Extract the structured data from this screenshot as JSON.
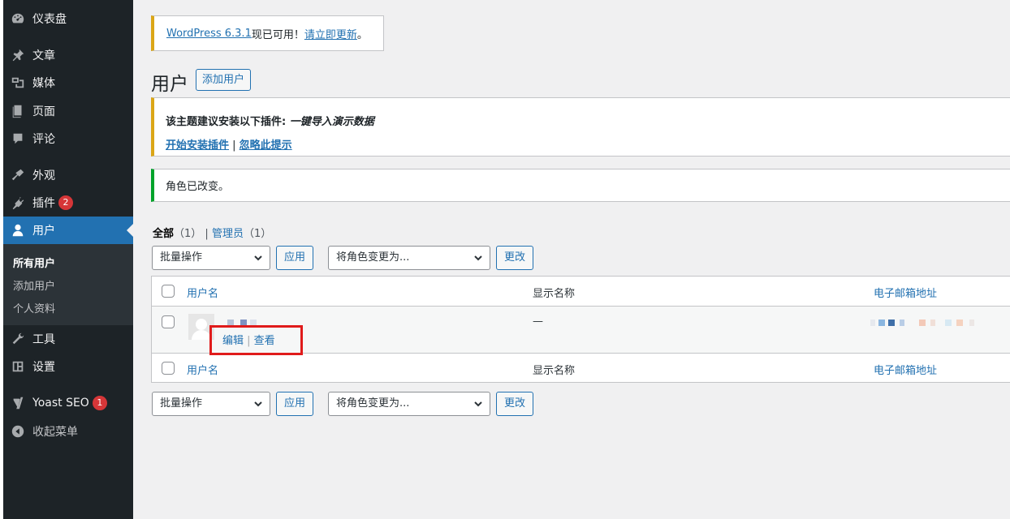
{
  "sidebar": {
    "items": [
      {
        "label": "仪表盘",
        "icon": "dashboard-icon"
      },
      {
        "label": "文章",
        "icon": "pin-icon"
      },
      {
        "label": "媒体",
        "icon": "media-icon"
      },
      {
        "label": "页面",
        "icon": "page-icon"
      },
      {
        "label": "评论",
        "icon": "comment-icon"
      },
      {
        "label": "外观",
        "icon": "appearance-icon"
      },
      {
        "label": "插件",
        "icon": "plugin-icon",
        "badge": "2"
      },
      {
        "label": "用户",
        "icon": "user-icon",
        "active": true
      },
      {
        "label": "工具",
        "icon": "wrench-icon"
      },
      {
        "label": "设置",
        "icon": "settings-icon"
      },
      {
        "label": "Yoast SEO",
        "icon": "yoast-icon",
        "badge": "1"
      },
      {
        "label": "收起菜单",
        "icon": "collapse-icon"
      }
    ],
    "submenu": [
      "所有用户",
      "添加用户",
      "个人资料"
    ]
  },
  "update_nag": {
    "version_link": "WordPress 6.3.1",
    "middle": "现已可用！",
    "action_link": "请立即更新",
    "end": "。"
  },
  "page": {
    "title": "用户",
    "add_button": "添加用户"
  },
  "plugin_notice": {
    "prefix": "该主题建议安装以下插件: ",
    "plugin": "一键导入演示数据",
    "install_link": "开始安装插件",
    "sep": " | ",
    "dismiss_link": "忽略此提示"
  },
  "success_notice": "角色已改变。",
  "filters": {
    "all_label": "全部",
    "all_count": "（1）",
    "sep": " | ",
    "admin_label": "管理员",
    "admin_count": "（1）"
  },
  "bulk": {
    "select_label": "批量操作",
    "apply": "应用",
    "role_select": "将角色变更为...",
    "change": "更改"
  },
  "table": {
    "columns": {
      "username": "用户名",
      "display_name": "显示名称",
      "email": "电子邮箱地址"
    },
    "rows": [
      {
        "display_name": "—",
        "actions": {
          "edit": "编辑",
          "sep": " | ",
          "view": "查看"
        }
      }
    ]
  },
  "colors": {
    "sidebar_bg": "#1d2327",
    "accent": "#2271b1",
    "badge": "#d63638",
    "highlight": "#e01b1b"
  }
}
